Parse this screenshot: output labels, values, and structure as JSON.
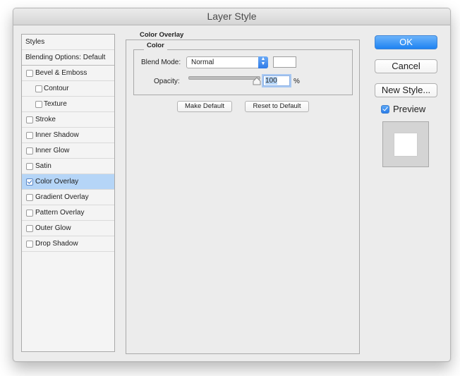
{
  "window": {
    "title": "Layer Style"
  },
  "styles_list": {
    "header": "Styles",
    "blending_options": "Blending Options: Default",
    "items": [
      {
        "label": "Bevel & Emboss",
        "checked": false,
        "indent": false,
        "selected": false
      },
      {
        "label": "Contour",
        "checked": false,
        "indent": true,
        "selected": false
      },
      {
        "label": "Texture",
        "checked": false,
        "indent": true,
        "selected": false
      },
      {
        "label": "Stroke",
        "checked": false,
        "indent": false,
        "selected": false
      },
      {
        "label": "Inner Shadow",
        "checked": false,
        "indent": false,
        "selected": false
      },
      {
        "label": "Inner Glow",
        "checked": false,
        "indent": false,
        "selected": false
      },
      {
        "label": "Satin",
        "checked": false,
        "indent": false,
        "selected": false
      },
      {
        "label": "Color Overlay",
        "checked": true,
        "indent": false,
        "selected": true
      },
      {
        "label": "Gradient Overlay",
        "checked": false,
        "indent": false,
        "selected": false
      },
      {
        "label": "Pattern Overlay",
        "checked": false,
        "indent": false,
        "selected": false
      },
      {
        "label": "Outer Glow",
        "checked": false,
        "indent": false,
        "selected": false
      },
      {
        "label": "Drop Shadow",
        "checked": false,
        "indent": false,
        "selected": false
      }
    ]
  },
  "panel": {
    "title": "Color Overlay",
    "group_title": "Color",
    "blend_mode_label": "Blend Mode:",
    "blend_mode_value": "Normal",
    "overlay_color": "#ffffff",
    "opacity_label": "Opacity:",
    "opacity_value": "100",
    "opacity_unit": "%",
    "opacity_fraction": 1.0,
    "make_default": "Make Default",
    "reset_default": "Reset to Default"
  },
  "actions": {
    "ok": "OK",
    "cancel": "Cancel",
    "new_style": "New Style...",
    "preview_label": "Preview",
    "preview_checked": true
  },
  "colors": {
    "accent": "#2e7be8",
    "selection": "#b5d5f7"
  }
}
